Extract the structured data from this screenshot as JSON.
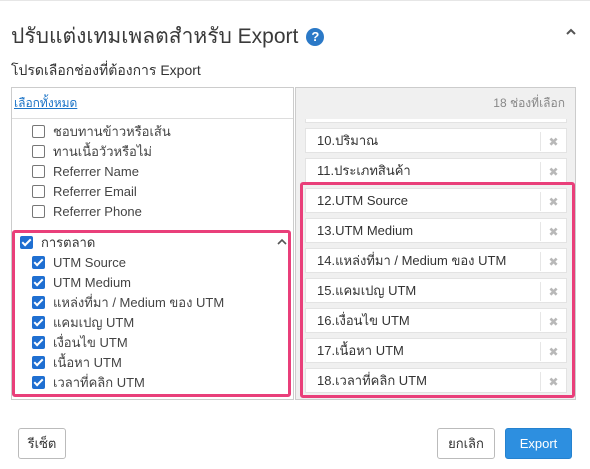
{
  "dialog": {
    "title": "ปรับแต่งเทมเพลตสำหรับ Export",
    "subtitle": "โปรดเลือกช่องที่ต้องการ Export",
    "help_icon": "question-circle-icon",
    "collapse_icon": "chevron-up-icon"
  },
  "left": {
    "select_all": "เลือกทั้งหมด",
    "items": [
      {
        "label": "ชอบทานข้าวหรือเส้น",
        "checked": false
      },
      {
        "label": "ทานเนื้อวัวหรือไม่",
        "checked": false
      },
      {
        "label": "Referrer Name",
        "checked": false
      },
      {
        "label": "Referrer Email",
        "checked": false
      },
      {
        "label": "Referrer Phone",
        "checked": false
      }
    ],
    "group": {
      "label": "การตลาด",
      "checked": true,
      "items": [
        {
          "label": "UTM Source",
          "checked": true
        },
        {
          "label": "UTM Medium",
          "checked": true
        },
        {
          "label": "แหล่งที่มา / Medium ของ UTM",
          "checked": true
        },
        {
          "label": "แคมเปญ UTM",
          "checked": true
        },
        {
          "label": "เงื่อนไข UTM",
          "checked": true
        },
        {
          "label": "เนื้อหา UTM",
          "checked": true
        },
        {
          "label": "เวลาที่คลิก UTM",
          "checked": true
        }
      ]
    }
  },
  "right": {
    "count_label": "18 ช่องที่เลือก",
    "items": [
      "10.ปริมาณ",
      "11.ประเภทสินค้า",
      "12.UTM Source",
      "13.UTM Medium",
      "14.แหล่งที่มา / Medium ของ UTM",
      "15.แคมเปญ UTM",
      "16.เงื่อนไข UTM",
      "17.เนื้อหา UTM",
      "18.เวลาที่คลิก UTM"
    ]
  },
  "footer": {
    "reset": "รีเซ็ต",
    "cancel": "ยกเลิก",
    "export": "Export"
  },
  "colors": {
    "accent": "#2d8fe0",
    "highlight": "#e93f7a",
    "checkbox": "#1f6fd1"
  }
}
